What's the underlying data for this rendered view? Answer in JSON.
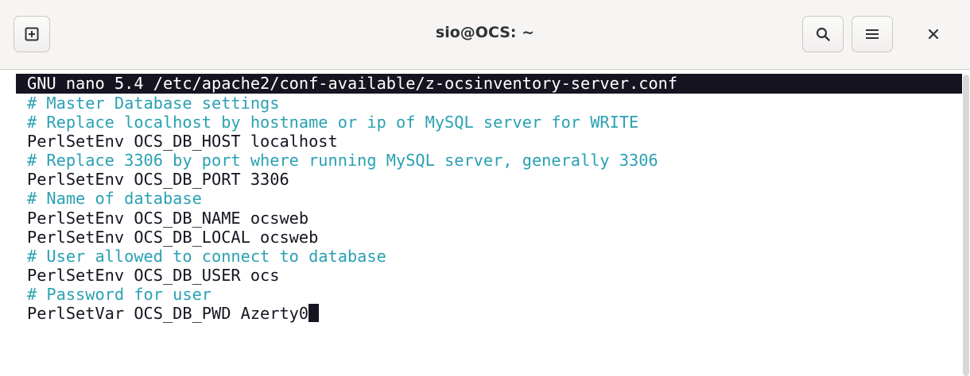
{
  "window": {
    "title": "sio@OCS: ~"
  },
  "headerbar": {
    "new_tab_icon": "new-tab-icon",
    "search_icon": "search-icon",
    "menu_icon": "hamburger-menu-icon",
    "close_icon": "close-icon"
  },
  "editor": {
    "header": "GNU nano 5.4 /etc/apache2/conf-available/z-ocsinventory-server.conf",
    "lines": [
      {
        "kind": "comment",
        "text": "# Master Database settings"
      },
      {
        "kind": "comment",
        "text": "# Replace localhost by hostname or ip of MySQL server for WRITE"
      },
      {
        "kind": "code",
        "text": "PerlSetEnv OCS_DB_HOST localhost"
      },
      {
        "kind": "comment",
        "text": "# Replace 3306 by port where running MySQL server, generally 3306"
      },
      {
        "kind": "code",
        "text": "PerlSetEnv OCS_DB_PORT 3306"
      },
      {
        "kind": "comment",
        "text": "# Name of database"
      },
      {
        "kind": "code",
        "text": "PerlSetEnv OCS_DB_NAME ocsweb"
      },
      {
        "kind": "code",
        "text": "PerlSetEnv OCS_DB_LOCAL ocsweb"
      },
      {
        "kind": "comment",
        "text": "# User allowed to connect to database"
      },
      {
        "kind": "code",
        "text": "PerlSetEnv OCS_DB_USER ocs"
      },
      {
        "kind": "comment",
        "text": "# Password for user"
      },
      {
        "kind": "code",
        "text": "PerlSetVar OCS_DB_PWD Azerty0"
      }
    ]
  },
  "colors": {
    "comment": "#2aa1b3",
    "text": "#171421",
    "header_bg": "#171421",
    "header_fg": "#ffffff",
    "titlebar_bg": "#f6f5f4"
  }
}
